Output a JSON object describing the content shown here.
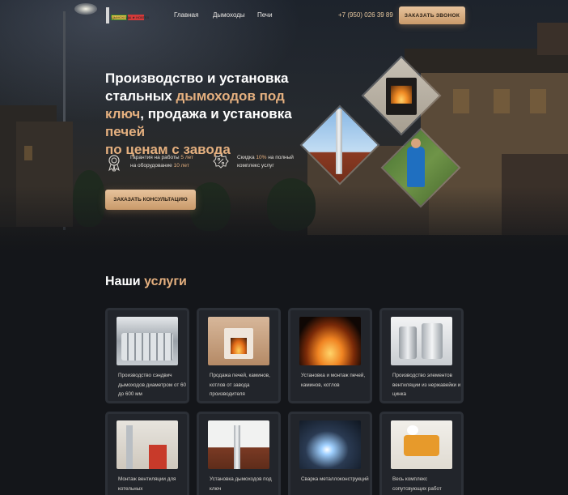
{
  "header": {
    "logo_text": "ДЫМОХОДЫ ★ НОВТЕХ",
    "nav": [
      "Главная",
      "Дымоходы",
      "Печи"
    ],
    "phone": "+7 (950) 026 39 89",
    "call_button": "ЗАКАЗАТЬ ЗВОНОК"
  },
  "hero": {
    "title_parts": [
      {
        "text": "Производство и установка ",
        "accent": false
      },
      {
        "text": "стальных ",
        "accent": false
      },
      {
        "text": "дымоходов под ключ",
        "accent": true
      },
      {
        "text": ", продажа и установка ",
        "accent": false
      },
      {
        "text": "печей",
        "accent": true
      },
      {
        "text": " ",
        "accent": false
      },
      {
        "text": "по ценам с завода",
        "accent": true
      }
    ],
    "features": [
      {
        "icon": "medal-icon",
        "line1_a": "Гарантия на работы ",
        "line1_b": "5 лет",
        "line2_a": "на оборудование ",
        "line2_b": "10 лет"
      },
      {
        "icon": "discount-icon",
        "line1_a": "Скидка ",
        "line1_b": "10%",
        "line1_c": " на полный",
        "line2_a": "комплекс услуг"
      }
    ],
    "consult_button": "ЗАКАЗАТЬ КОНСУЛЬТАЦИЮ",
    "diamond_images": [
      "stove-photo",
      "chimney-photo",
      "installer-photo"
    ]
  },
  "services": {
    "title_a": "Наши ",
    "title_b": "услуги",
    "cards": [
      {
        "text": "Производство сэндвич дымоходов диаметром от 60 до 600 мм",
        "image": "sandwich-pipes-photo"
      },
      {
        "text": "Продажа печей, каминов, котлов от завода производителя",
        "image": "fireplace-photo"
      },
      {
        "text": "Установка и монтаж печей, каминов, котлов",
        "image": "fire-photo"
      },
      {
        "text": "Производство элементов вентиляции из нержавейки и цинка",
        "image": "ventilation-elements-photo"
      },
      {
        "text": "Монтаж вентиляции для котельных",
        "image": "boiler-room-photo"
      },
      {
        "text": "Установка дымоходов под ключ",
        "image": "roof-chimney-photo"
      },
      {
        "text": "Сварка металлоконструкций",
        "image": "welding-photo"
      },
      {
        "text": "Весь комплекс сопутсвующих работ",
        "image": "workers-photo"
      }
    ]
  },
  "colors": {
    "accent": "#e5b07f",
    "button": "#d4aa7e",
    "background": "#14161a",
    "card": "#22252b"
  }
}
